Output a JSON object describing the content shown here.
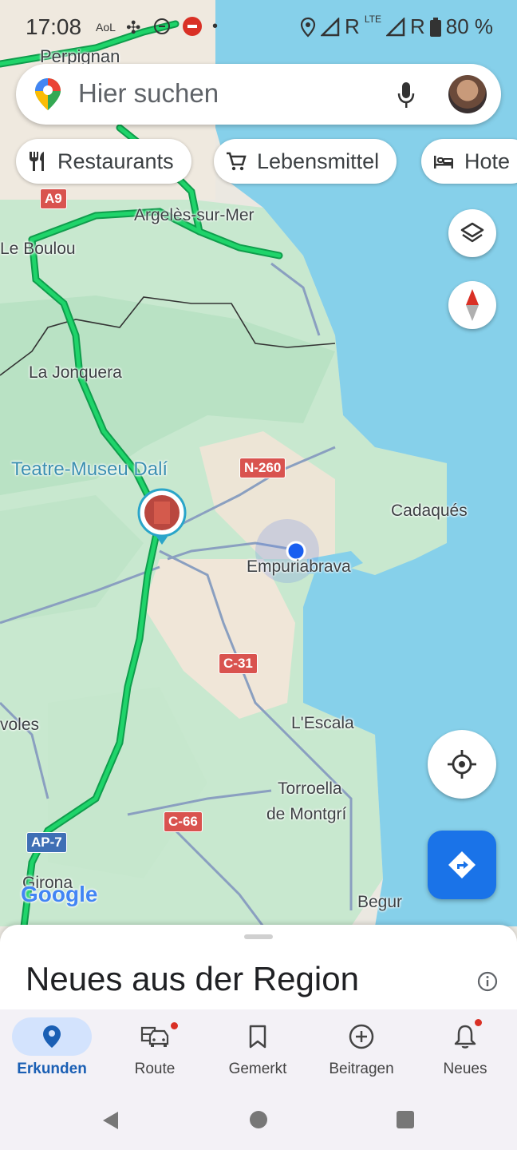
{
  "status_bar": {
    "time": "17:08",
    "mini_label": "AoL",
    "signal_roaming_1": "R",
    "lte": "LTE",
    "signal_roaming_2": "R",
    "battery": "80 %"
  },
  "search": {
    "placeholder": "Hier suchen"
  },
  "chips": [
    {
      "label": "Restaurants",
      "icon": "fork-knife-icon"
    },
    {
      "label": "Lebensmittel",
      "icon": "shopping-cart-icon"
    },
    {
      "label": "Hote",
      "icon": "bed-icon"
    }
  ],
  "map": {
    "places": {
      "perpignan": "Perpignan",
      "argeles": "Argelès-sur-Mer",
      "le_boulou": "Le Boulou",
      "la_jonquera": "La Jonquera",
      "teatre_museu": "Teatre-Museu Dalí",
      "cadaques": "Cadaqués",
      "empuriabrava": "Empuriabrava",
      "lescala": "L'Escala",
      "torroella_1": "Torroella",
      "torroella_2": "de Montgrí",
      "voles": "voles",
      "girona": "Girona",
      "begur": "Begur"
    },
    "roads": {
      "a9": "A9",
      "n260": "N-260",
      "c31": "C-31",
      "c66": "C-66",
      "ap7": "AP-7"
    },
    "logo": "Google"
  },
  "sheet": {
    "title": "Neues aus der Region"
  },
  "bottom_nav": [
    {
      "label": "Erkunden",
      "icon": "explore-pin-icon",
      "active": true
    },
    {
      "label": "Route",
      "icon": "commute-car-icon",
      "badge": true
    },
    {
      "label": "Gemerkt",
      "icon": "bookmark-icon"
    },
    {
      "label": "Beitragen",
      "icon": "add-circle-icon"
    },
    {
      "label": "Neues",
      "icon": "bell-icon",
      "badge": true
    }
  ],
  "colors": {
    "water": "#86d0ea",
    "park": "#bfe4c8",
    "land": "#ebe8e1",
    "highway": "#1fbf5a",
    "accent": "#1a73e8",
    "shield_red": "#d9534f"
  }
}
